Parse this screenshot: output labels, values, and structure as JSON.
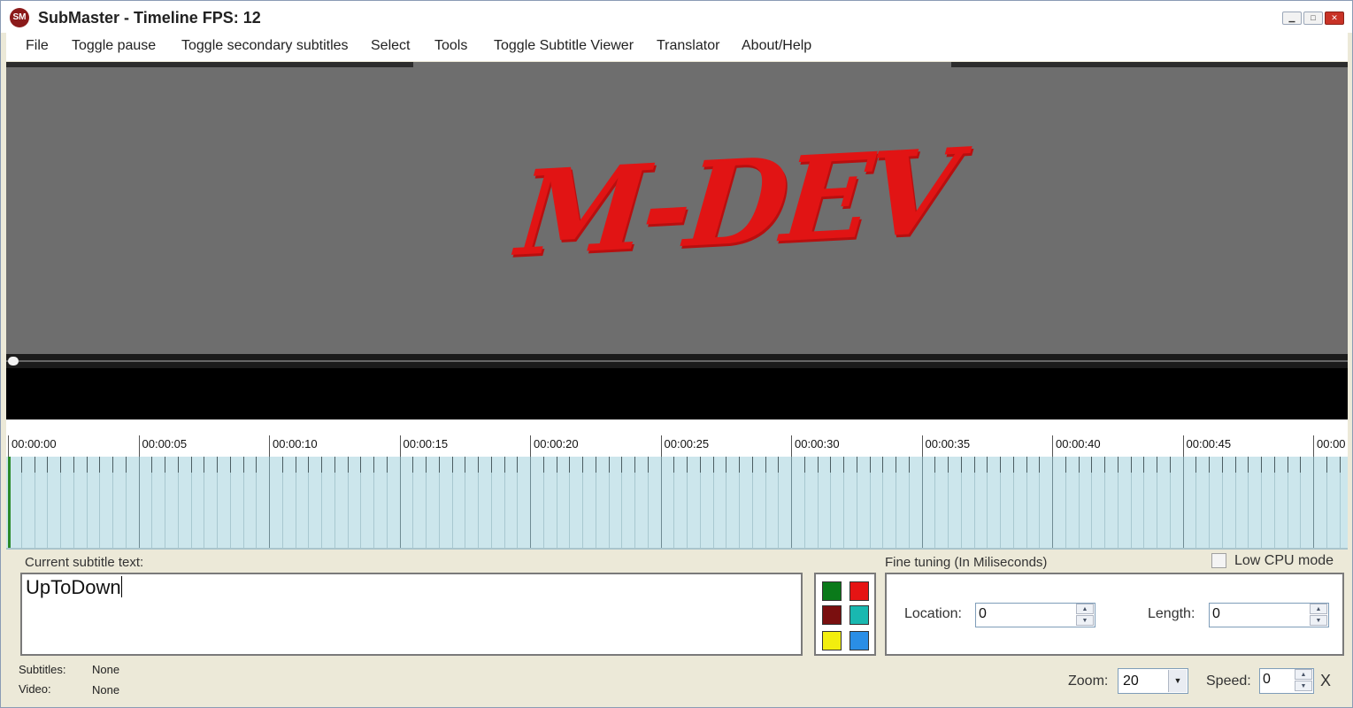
{
  "window": {
    "title": "SubMaster - Timeline FPS: 12",
    "icon_text": "SM",
    "buttons": {
      "minimize": "▁",
      "maximize": "□",
      "close": "✕"
    }
  },
  "menu": [
    "File",
    "Toggle pause",
    "Toggle secondary subtitles",
    "Select",
    "Tools",
    "Toggle Subtitle Viewer",
    "Translator",
    "About/Help"
  ],
  "video": {
    "logo_text": "M-DEV",
    "logo_color": "#e11414"
  },
  "timeline": {
    "labels": [
      "00:00:00",
      "00:00:05",
      "00:00:10",
      "00:00:15",
      "00:00:20",
      "00:00:25",
      "00:00:30",
      "00:00:35",
      "00:00:40",
      "00:00:45",
      "00:00"
    ],
    "background_color": "#cce6ec",
    "cursor_color": "#2a8a2a"
  },
  "editor": {
    "current_label": "Current subtitle text:",
    "current_text": "UpToDown",
    "colors": [
      "#0a7a1a",
      "#e51414",
      "#7a0f0f",
      "#19b8b0",
      "#f2ee0e",
      "#2a8ee6"
    ]
  },
  "fine_tuning": {
    "label": "Fine tuning (In Miliseconds)",
    "location_label": "Location:",
    "location_value": "0",
    "length_label": "Length:",
    "length_value": "0"
  },
  "low_cpu_label": "Low CPU mode",
  "status": {
    "subtitles_label": "Subtitles:",
    "subtitles_value": "None",
    "video_label": "Video:",
    "video_value": "None"
  },
  "controls": {
    "zoom_label": "Zoom:",
    "zoom_value": "20",
    "speed_label": "Speed:",
    "speed_value": "0",
    "reset_symbol": "X"
  }
}
